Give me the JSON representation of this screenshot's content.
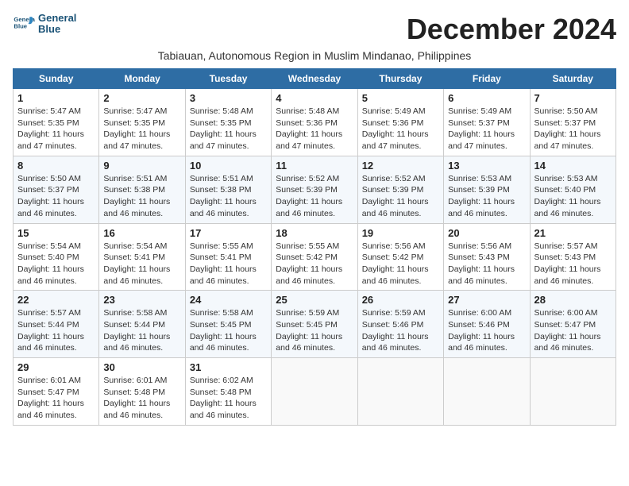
{
  "logo": {
    "line1": "General",
    "line2": "Blue"
  },
  "title": "December 2024",
  "subtitle": "Tabiauan, Autonomous Region in Muslim Mindanao, Philippines",
  "header": {
    "days": [
      "Sunday",
      "Monday",
      "Tuesday",
      "Wednesday",
      "Thursday",
      "Friday",
      "Saturday"
    ]
  },
  "weeks": [
    [
      {
        "day": "1",
        "info": "Sunrise: 5:47 AM\nSunset: 5:35 PM\nDaylight: 11 hours\nand 47 minutes."
      },
      {
        "day": "2",
        "info": "Sunrise: 5:47 AM\nSunset: 5:35 PM\nDaylight: 11 hours\nand 47 minutes."
      },
      {
        "day": "3",
        "info": "Sunrise: 5:48 AM\nSunset: 5:35 PM\nDaylight: 11 hours\nand 47 minutes."
      },
      {
        "day": "4",
        "info": "Sunrise: 5:48 AM\nSunset: 5:36 PM\nDaylight: 11 hours\nand 47 minutes."
      },
      {
        "day": "5",
        "info": "Sunrise: 5:49 AM\nSunset: 5:36 PM\nDaylight: 11 hours\nand 47 minutes."
      },
      {
        "day": "6",
        "info": "Sunrise: 5:49 AM\nSunset: 5:37 PM\nDaylight: 11 hours\nand 47 minutes."
      },
      {
        "day": "7",
        "info": "Sunrise: 5:50 AM\nSunset: 5:37 PM\nDaylight: 11 hours\nand 47 minutes."
      }
    ],
    [
      {
        "day": "8",
        "info": "Sunrise: 5:50 AM\nSunset: 5:37 PM\nDaylight: 11 hours\nand 46 minutes."
      },
      {
        "day": "9",
        "info": "Sunrise: 5:51 AM\nSunset: 5:38 PM\nDaylight: 11 hours\nand 46 minutes."
      },
      {
        "day": "10",
        "info": "Sunrise: 5:51 AM\nSunset: 5:38 PM\nDaylight: 11 hours\nand 46 minutes."
      },
      {
        "day": "11",
        "info": "Sunrise: 5:52 AM\nSunset: 5:39 PM\nDaylight: 11 hours\nand 46 minutes."
      },
      {
        "day": "12",
        "info": "Sunrise: 5:52 AM\nSunset: 5:39 PM\nDaylight: 11 hours\nand 46 minutes."
      },
      {
        "day": "13",
        "info": "Sunrise: 5:53 AM\nSunset: 5:39 PM\nDaylight: 11 hours\nand 46 minutes."
      },
      {
        "day": "14",
        "info": "Sunrise: 5:53 AM\nSunset: 5:40 PM\nDaylight: 11 hours\nand 46 minutes."
      }
    ],
    [
      {
        "day": "15",
        "info": "Sunrise: 5:54 AM\nSunset: 5:40 PM\nDaylight: 11 hours\nand 46 minutes."
      },
      {
        "day": "16",
        "info": "Sunrise: 5:54 AM\nSunset: 5:41 PM\nDaylight: 11 hours\nand 46 minutes."
      },
      {
        "day": "17",
        "info": "Sunrise: 5:55 AM\nSunset: 5:41 PM\nDaylight: 11 hours\nand 46 minutes."
      },
      {
        "day": "18",
        "info": "Sunrise: 5:55 AM\nSunset: 5:42 PM\nDaylight: 11 hours\nand 46 minutes."
      },
      {
        "day": "19",
        "info": "Sunrise: 5:56 AM\nSunset: 5:42 PM\nDaylight: 11 hours\nand 46 minutes."
      },
      {
        "day": "20",
        "info": "Sunrise: 5:56 AM\nSunset: 5:43 PM\nDaylight: 11 hours\nand 46 minutes."
      },
      {
        "day": "21",
        "info": "Sunrise: 5:57 AM\nSunset: 5:43 PM\nDaylight: 11 hours\nand 46 minutes."
      }
    ],
    [
      {
        "day": "22",
        "info": "Sunrise: 5:57 AM\nSunset: 5:44 PM\nDaylight: 11 hours\nand 46 minutes."
      },
      {
        "day": "23",
        "info": "Sunrise: 5:58 AM\nSunset: 5:44 PM\nDaylight: 11 hours\nand 46 minutes."
      },
      {
        "day": "24",
        "info": "Sunrise: 5:58 AM\nSunset: 5:45 PM\nDaylight: 11 hours\nand 46 minutes."
      },
      {
        "day": "25",
        "info": "Sunrise: 5:59 AM\nSunset: 5:45 PM\nDaylight: 11 hours\nand 46 minutes."
      },
      {
        "day": "26",
        "info": "Sunrise: 5:59 AM\nSunset: 5:46 PM\nDaylight: 11 hours\nand 46 minutes."
      },
      {
        "day": "27",
        "info": "Sunrise: 6:00 AM\nSunset: 5:46 PM\nDaylight: 11 hours\nand 46 minutes."
      },
      {
        "day": "28",
        "info": "Sunrise: 6:00 AM\nSunset: 5:47 PM\nDaylight: 11 hours\nand 46 minutes."
      }
    ],
    [
      {
        "day": "29",
        "info": "Sunrise: 6:01 AM\nSunset: 5:47 PM\nDaylight: 11 hours\nand 46 minutes."
      },
      {
        "day": "30",
        "info": "Sunrise: 6:01 AM\nSunset: 5:48 PM\nDaylight: 11 hours\nand 46 minutes."
      },
      {
        "day": "31",
        "info": "Sunrise: 6:02 AM\nSunset: 5:48 PM\nDaylight: 11 hours\nand 46 minutes."
      },
      {
        "day": "",
        "info": ""
      },
      {
        "day": "",
        "info": ""
      },
      {
        "day": "",
        "info": ""
      },
      {
        "day": "",
        "info": ""
      }
    ]
  ]
}
